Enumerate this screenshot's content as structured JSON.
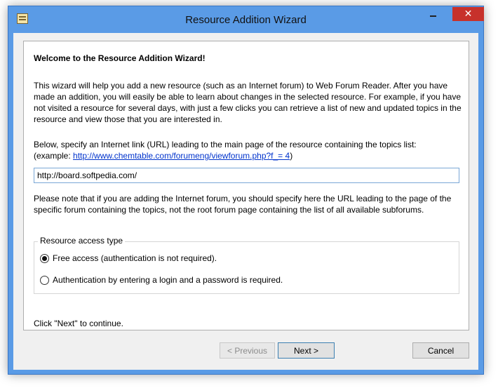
{
  "window": {
    "title": "Resource Addition Wizard",
    "close_glyph": "✕"
  },
  "page": {
    "heading": "Welcome to the Resource Addition Wizard!",
    "intro": "This wizard will help you add a new resource (such as an Internet forum) to Web Forum Reader. After you have made an addition, you will easily be able to learn about changes in the selected resource. For example, if you have not visited a resource for several days, with just a few clicks you can retrieve a list of new and updated topics in the resource and view those that you are interested in.",
    "url_prompt": "Below, specify an Internet link (URL) leading to the main page of the resource containing the topics list:",
    "example_prefix": "(example: ",
    "example_link": "http://www.chemtable.com/forumeng/viewforum.php?f_= 4",
    "example_suffix": ")",
    "url_value": "http://board.softpedia.com/",
    "note": "Please note that if you are adding the Internet forum, you should specify here the URL leading to the page of the specific forum containing the topics, not the root forum page containing the list of all available subforums.",
    "access_group_label": "Resource access type",
    "access_options": [
      {
        "label": "Free access (authentication is not required).",
        "checked": true
      },
      {
        "label": "Authentication by entering a login and a password is required.",
        "checked": false
      }
    ],
    "continue_text": "Click \"Next\" to continue."
  },
  "buttons": {
    "previous": "< Previous",
    "next": "Next >",
    "cancel": "Cancel"
  }
}
